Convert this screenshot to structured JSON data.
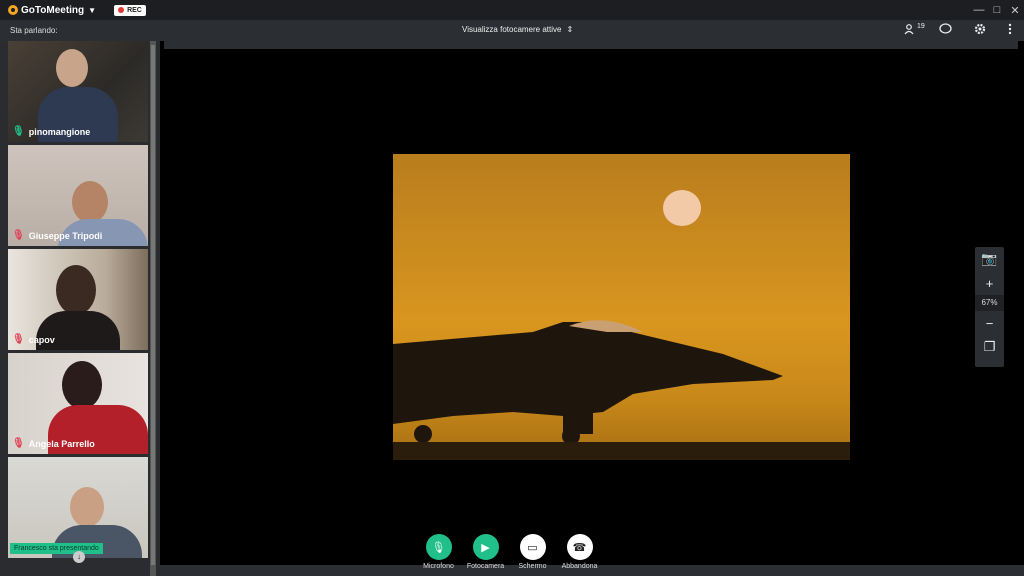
{
  "titlebar": {
    "brand": "GoToMeeting",
    "rec_label": "REC",
    "minimize_icon": "—",
    "maximize_icon": "□",
    "close_icon": "✕"
  },
  "subbar": {
    "speaking_label": "Sta parlando:",
    "view_select_value": "Visualizza fotocamere attive",
    "attendee_count": "19"
  },
  "participants": [
    {
      "name": "pinomangione",
      "mic": "on"
    },
    {
      "name": "Giuseppe Tripodi",
      "mic": "off"
    },
    {
      "name": "capov",
      "mic": "off"
    },
    {
      "name": "Angela Parrello",
      "mic": "off"
    },
    {
      "name": "",
      "mic": "none"
    }
  ],
  "presenting_label": "Francesco sta presentando",
  "zoom": {
    "value": "67%"
  },
  "controls": {
    "microphone": "Microfono",
    "camera": "Fotocamera",
    "screen": "Schermo",
    "leave": "Abbandona"
  },
  "colors": {
    "accent": "#21c08b",
    "mic_muted": "#e0455a",
    "rec_dot": "#e53935",
    "brand_logo": "#f5a623"
  }
}
